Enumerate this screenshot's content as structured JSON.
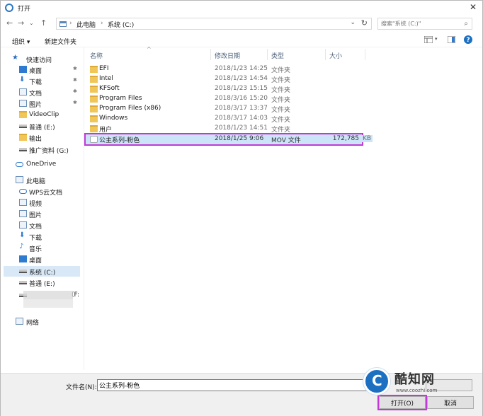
{
  "window": {
    "title": "打开"
  },
  "address": {
    "crumbs": [
      "此电脑",
      "系统 (C:)"
    ],
    "search_placeholder": "搜索\"系统 (C:)\""
  },
  "toolbar": {
    "organize": "组织 ▾",
    "new_folder": "新建文件夹"
  },
  "columns": {
    "name": "名称",
    "date": "修改日期",
    "type": "类型",
    "size": "大小"
  },
  "nav": {
    "quick_access": "快速访问",
    "desktop": "桌面",
    "downloads": "下载",
    "documents": "文档",
    "pictures": "图片",
    "videoclip": "VideoClip",
    "drive_e": "普通 (E:)",
    "output": "输出",
    "promo": "推广资料 (G:)",
    "onedrive": "OneDrive",
    "this_pc": "此电脑",
    "wps": "WPS云文档",
    "videos": "视频",
    "pc_pictures": "图片",
    "pc_documents": "文档",
    "pc_downloads": "下载",
    "music": "音乐",
    "pc_desktop": "桌面",
    "drive_c": "系统 (C:)",
    "drive_e2": "普通 (E:)",
    "drive_f": "(F:",
    "network": "网络"
  },
  "files": [
    {
      "name": "EFI",
      "date": "2018/1/23 14:25",
      "type": "文件夹",
      "size": ""
    },
    {
      "name": "Intel",
      "date": "2018/1/23 14:54",
      "type": "文件夹",
      "size": ""
    },
    {
      "name": "KFSoft",
      "date": "2018/1/23 15:15",
      "type": "文件夹",
      "size": ""
    },
    {
      "name": "Program Files",
      "date": "2018/3/16 15:20",
      "type": "文件夹",
      "size": ""
    },
    {
      "name": "Program Files (x86)",
      "date": "2018/3/17 13:37",
      "type": "文件夹",
      "size": ""
    },
    {
      "name": "Windows",
      "date": "2018/3/17 14:03",
      "type": "文件夹",
      "size": ""
    },
    {
      "name": "用户",
      "date": "2018/1/23 14:51",
      "type": "文件夹",
      "size": ""
    },
    {
      "name": "公主系列-粉色",
      "date": "2018/1/25 9:06",
      "type": "MOV 文件",
      "size": "172,785",
      "unit": "KB"
    }
  ],
  "bottom": {
    "filename_label": "文件名(N):",
    "filename_value": "公主系列-粉色",
    "open": "打开(O)",
    "cancel": "取消"
  },
  "watermark": {
    "text": "酷知网",
    "url": "www.coozhi.com"
  },
  "colors": {
    "accent": "#2f7bd1",
    "highlight": "#c13ad8",
    "selection": "#cce4f7"
  }
}
